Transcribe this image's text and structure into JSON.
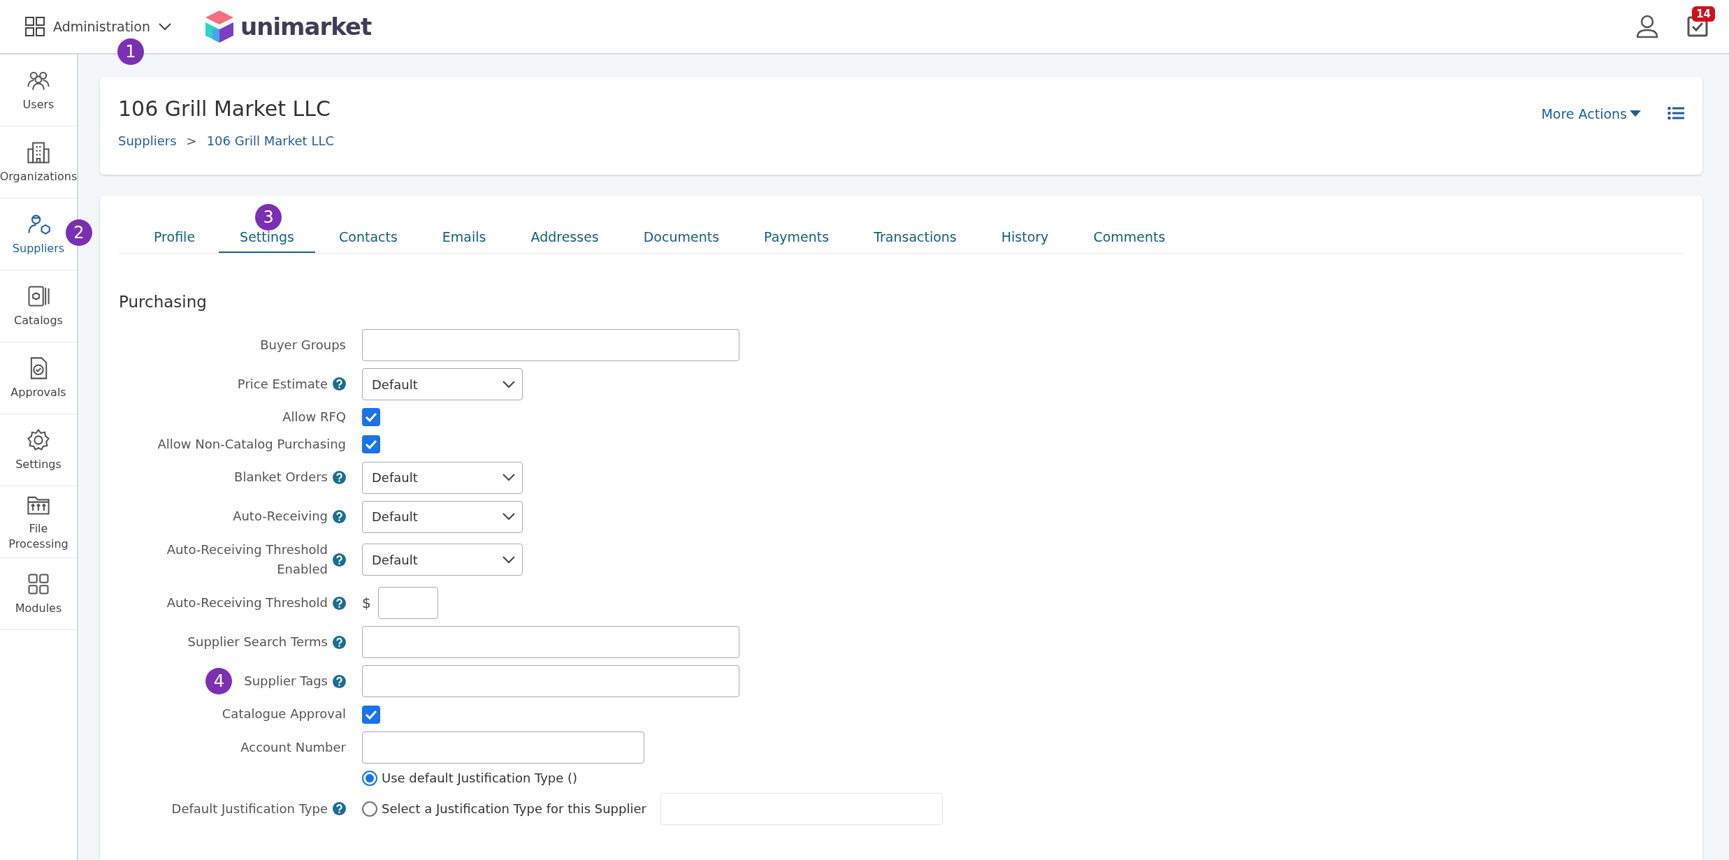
{
  "topbar": {
    "menu_label": "Administration",
    "callout": "1",
    "logo_text": "unimarket",
    "tasks_badge": "14"
  },
  "sidebar": {
    "items": [
      {
        "label": "Users",
        "selected": false
      },
      {
        "label": "Organizations",
        "selected": false
      },
      {
        "label": "Suppliers",
        "selected": true,
        "callout": "2"
      },
      {
        "label": "Catalogs",
        "selected": false
      },
      {
        "label": "Approvals",
        "selected": false
      },
      {
        "label": "Settings",
        "selected": false
      },
      {
        "label": "File Processing",
        "selected": false
      },
      {
        "label": "Modules",
        "selected": false
      }
    ]
  },
  "header": {
    "title": "106 Grill Market LLC",
    "breadcrumb": [
      "Suppliers",
      "106 Grill Market LLC"
    ],
    "breadcrumb_separator": ">",
    "more_actions": "More Actions"
  },
  "tabs": [
    {
      "label": "Profile",
      "selected": false
    },
    {
      "label": "Settings",
      "selected": true,
      "callout": "3"
    },
    {
      "label": "Contacts",
      "selected": false
    },
    {
      "label": "Emails",
      "selected": false
    },
    {
      "label": "Addresses",
      "selected": false
    },
    {
      "label": "Documents",
      "selected": false
    },
    {
      "label": "Payments",
      "selected": false
    },
    {
      "label": "Transactions",
      "selected": false
    },
    {
      "label": "History",
      "selected": false
    },
    {
      "label": "Comments",
      "selected": false
    }
  ],
  "section_title": "Purchasing",
  "fields": [
    {
      "kind": "text",
      "label": "Buyer Groups",
      "help": false
    },
    {
      "kind": "select",
      "label": "Price Estimate",
      "help": true,
      "value": "Default"
    },
    {
      "kind": "checkbox",
      "label": "Allow RFQ",
      "help": false,
      "checked": true
    },
    {
      "kind": "checkbox",
      "label": "Allow Non-Catalog Purchasing",
      "help": false,
      "checked": true
    },
    {
      "kind": "select",
      "label": "Blanket Orders",
      "help": true,
      "value": "Default"
    },
    {
      "kind": "select",
      "label": "Auto-Receiving",
      "help": true,
      "value": "Default"
    },
    {
      "kind": "select",
      "label": "Auto-Receiving Threshold Enabled",
      "help": true,
      "value": "Default"
    },
    {
      "kind": "currency",
      "label": "Auto-Receiving Threshold",
      "help": true,
      "prefix": "$"
    },
    {
      "kind": "text",
      "label": "Supplier Search Terms",
      "help": true
    },
    {
      "kind": "text",
      "label": "Supplier Tags",
      "help": true,
      "callout": "4"
    },
    {
      "kind": "checkbox",
      "label": "Catalogue Approval",
      "help": false,
      "checked": true
    },
    {
      "kind": "short",
      "label": "Account Number",
      "help": false
    },
    {
      "kind": "radio",
      "label": "Default Justification Type",
      "help": true,
      "options": [
        {
          "label": "Use default Justification Type ()",
          "selected": true
        },
        {
          "label": "Select a Justification Type for this Supplier",
          "selected": false
        }
      ]
    }
  ]
}
